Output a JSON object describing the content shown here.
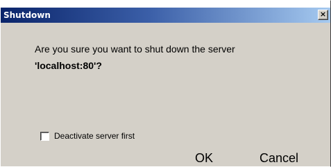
{
  "window": {
    "title": "Shutdown",
    "close_glyph": "×"
  },
  "message": {
    "line1": "Are you sure you want to shut down the server",
    "line2": "'localhost:80'?"
  },
  "options": {
    "deactivate_label": "Deactivate server first",
    "deactivate_checked": false
  },
  "buttons": {
    "ok_label": "OK",
    "cancel_label": "Cancel"
  },
  "colors": {
    "dialog_background": "#d4d0c8",
    "titlebar_start": "#0a246a",
    "titlebar_end": "#a6caf0",
    "title_text": "#ffffff"
  }
}
